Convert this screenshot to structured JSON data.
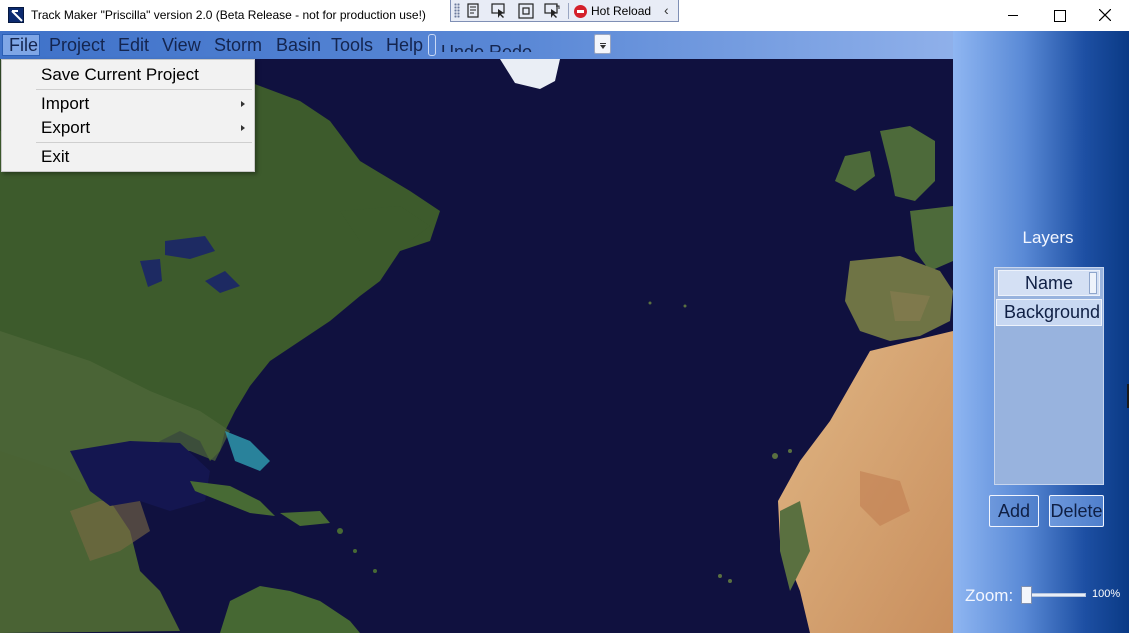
{
  "window": {
    "title": "Track Maker \"Priscilla\" version 2.0 (Beta Release - not for production use!)"
  },
  "debug_toolbar": {
    "hot_reload_label": "Hot Reload",
    "collapse_glyph": "‹"
  },
  "menubar": {
    "items": [
      "File",
      "Project",
      "Edit",
      "View",
      "Storm",
      "Basin",
      "Tools",
      "Help"
    ],
    "undo_redo": "Undo Redo"
  },
  "file_menu": {
    "items": [
      {
        "label": "Save Current Project",
        "submenu": false
      },
      {
        "label": "Import",
        "submenu": true
      },
      {
        "label": "Export",
        "submenu": true
      },
      {
        "label": "Exit",
        "submenu": false
      }
    ]
  },
  "sidebar": {
    "layers_title": "Layers",
    "layers_column_header": "Name",
    "layers": [
      "Background"
    ],
    "add_button": "Add",
    "delete_button": "Delete",
    "zoom_label": "Zoom:",
    "zoom_value": "100%"
  },
  "colors": {
    "ocean": "#10113f",
    "land_green": "#3b5a2c",
    "desert": "#d6a872",
    "menubar_start": "#3f72c9",
    "sidebar_dark": "#0a3a85"
  }
}
